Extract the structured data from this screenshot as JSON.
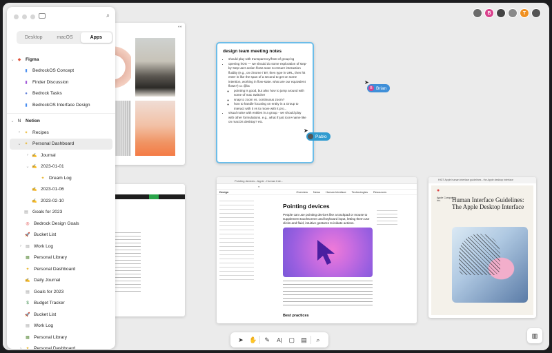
{
  "sidebar": {
    "tabs": [
      "Desktop",
      "macOS",
      "Apps"
    ],
    "active_tab": "Apps",
    "tree": [
      {
        "label": "Figma",
        "level": 0,
        "expanded": true,
        "icon": "figma-icon",
        "color": "#e0533c",
        "bold": true
      },
      {
        "label": "BedrockOS Concept",
        "level": 1,
        "icon": "file-icon",
        "color": "#4a8ef0"
      },
      {
        "label": "Finder Discussion",
        "level": 1,
        "icon": "file-icon",
        "color": "#a25bd8"
      },
      {
        "label": "Bedrock Tasks",
        "level": 1,
        "icon": "globe-icon",
        "color": "#5a7bd8"
      },
      {
        "label": "BedrockOS Interface Design",
        "level": 1,
        "icon": "file-icon",
        "color": "#4a8ef0"
      },
      {
        "label": "Notion",
        "level": 0,
        "expanded": true,
        "icon": "notion-icon",
        "color": "#222",
        "bold": true
      },
      {
        "label": "Recipes",
        "level": 1,
        "chev": true,
        "icon": "sparkle-icon",
        "color": "#e8b52a"
      },
      {
        "label": "Personal Dashboard",
        "level": 1,
        "chev": true,
        "expanded": true,
        "icon": "sparkle-icon",
        "color": "#e8b52a",
        "selected": true
      },
      {
        "label": "Journal",
        "level": 2,
        "chev": true,
        "icon": "pencil-icon",
        "color": "#d4a23a"
      },
      {
        "label": "2023-01-01",
        "level": 2,
        "chev": true,
        "expanded": true,
        "icon": "pencil-icon",
        "color": "#d4a23a"
      },
      {
        "label": "Dream Log",
        "level": 3,
        "icon": "sparkle-icon",
        "color": "#e8b52a"
      },
      {
        "label": "2023-01-06",
        "level": 2,
        "icon": "pencil-icon",
        "color": "#d4a23a"
      },
      {
        "label": "2023-02-10",
        "level": 2,
        "icon": "pencil-icon",
        "color": "#d4a23a"
      },
      {
        "label": "Goals for 2023",
        "level": 1,
        "icon": "doc-icon",
        "color": "#999"
      },
      {
        "label": "Bedrock Design Goals",
        "level": 0,
        "icon": "target-icon",
        "color": "#d33"
      },
      {
        "label": "Bucket List",
        "level": 0,
        "icon": "rocket-icon",
        "color": "#d44"
      },
      {
        "label": "Work Log",
        "level": 0,
        "chev": true,
        "icon": "doc-icon",
        "color": "#999"
      },
      {
        "label": "Personal Library",
        "level": 0,
        "icon": "books-icon",
        "color": "#5a8a3a"
      },
      {
        "label": "Personal Dashboard",
        "level": 0,
        "icon": "sparkle-icon",
        "color": "#e8b52a"
      },
      {
        "label": "Daily Journal",
        "level": 0,
        "icon": "pencil-icon",
        "color": "#d4a23a"
      },
      {
        "label": "Goals for 2023",
        "level": 0,
        "icon": "doc-icon",
        "color": "#999"
      },
      {
        "label": "Budget Tracker",
        "level": 0,
        "icon": "money-icon",
        "color": "#3a8a4a"
      },
      {
        "label": "Bucket List",
        "level": 0,
        "icon": "rocket-icon",
        "color": "#d44"
      },
      {
        "label": "Work Log",
        "level": 0,
        "icon": "doc-icon",
        "color": "#999"
      },
      {
        "label": "Personal Library",
        "level": 0,
        "icon": "books-icon",
        "color": "#5a8a3a"
      },
      {
        "label": "Personal Dashboard",
        "level": 0,
        "chev": true,
        "icon": "sparkle-icon",
        "color": "#e8b52a"
      }
    ]
  },
  "notes": {
    "title": "design team meeting notes",
    "items": [
      "should play with transparency/frost of group bg",
      "opening hOS — we should do some exploration of step-by-step user action flows soon to ensure interaction fluidity (e.g., on chrome / BT, then type in URL, then hit enter in like the span of a second to get on some intention, working in flow-state. what are our equivalent flows?) cc @bc",
      "pointing is good, but also how to jump around with some of mac Switcher",
      "snap to zoom vs. continuous zoom?",
      "how to handle focusing on entity in a Group to interact with it vs to move with it pro...",
      "visual noise with entities in a group - we should play with other formulations. e.g., what if just icon+name like on macOS desktop? etc."
    ]
  },
  "browser": {
    "tab_title": "Pointing devices - Apple - Human Inte...",
    "site_name": "Design",
    "nav": [
      "Overview",
      "News",
      "Human Interface",
      "Technologies",
      "Resources"
    ],
    "page_title": "Pointing devices",
    "intro": "People can use pointing devices like a trackpad or mouse to supplement touchscreen and keyboard input, letting them use clicks and fluid, intuitive gestures to initiate actions.",
    "section_heading": "Best practices"
  },
  "hig": {
    "tab_title": "HIGT Apple human interface guidelines - the Apple desktop interface",
    "title": "Human Interface Guidelines: The Apple Desktop Interface",
    "publisher": "Apple Computer, Inc."
  },
  "collaborators": [
    {
      "label": "",
      "color": "#6b6b6b"
    },
    {
      "label": "B",
      "color": "#d9418d"
    },
    {
      "label": "",
      "color": "#444"
    },
    {
      "label": "",
      "color": "#8a8a8a"
    },
    {
      "label": "T",
      "color": "#f09020"
    },
    {
      "label": "",
      "color": "#555"
    }
  ],
  "cursors": [
    {
      "name": "Brian",
      "color": "#3f8fd8"
    },
    {
      "name": "Pablo",
      "color": "#2f9bd0"
    }
  ],
  "toolbar": [
    "pointer-icon",
    "hand-icon",
    "pen-icon",
    "text-icon",
    "frame-icon",
    "sticky-icon",
    "search-icon"
  ],
  "colors": {
    "accent": "#46a7e8",
    "selected_card_border": "#6cbde9"
  }
}
